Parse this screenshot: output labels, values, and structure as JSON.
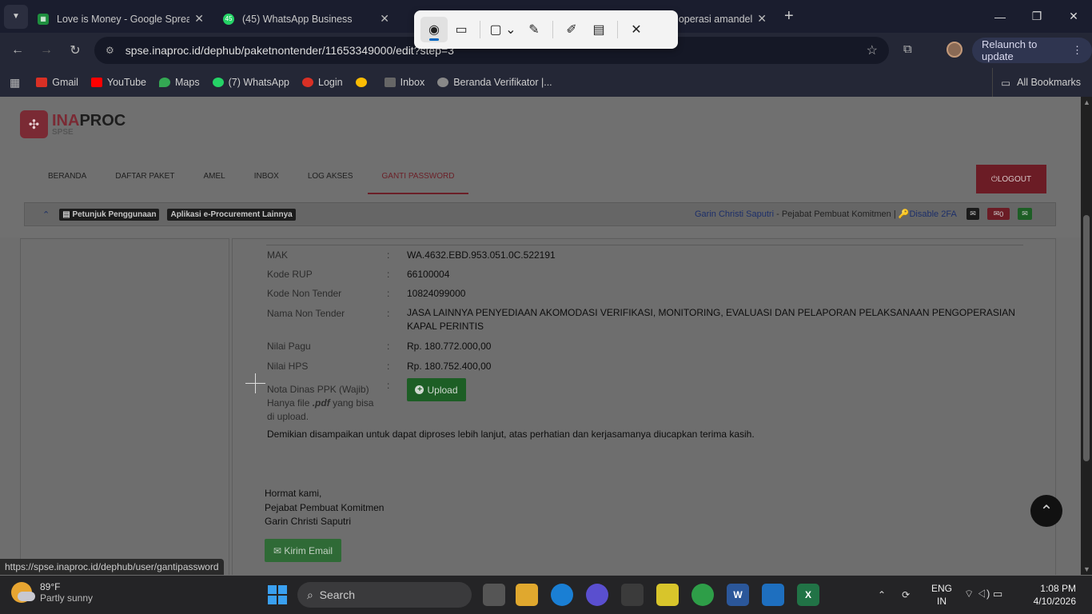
{
  "browser": {
    "tabs": [
      {
        "title": "Love is Money - Google Spread",
        "favicon_color": "#1e8e3e"
      },
      {
        "title": "(45) WhatsApp Business",
        "favicon_color": "#25d366",
        "badge": "45"
      },
      {
        "title": "",
        "favicon_color": "#888"
      },
      {
        "title": "a operasi amandel",
        "favicon_color": "#888"
      }
    ],
    "url": "spse.inaproc.id/dephub/paketnontender/11653349000/edit?step=3",
    "relaunch_label": "Relaunch to update",
    "bookmarks": [
      {
        "label": "Gmail",
        "color": "#d93025"
      },
      {
        "label": "YouTube",
        "color": "#ff0000"
      },
      {
        "label": "Maps",
        "color": "#34a853"
      },
      {
        "label": "(7) WhatsApp",
        "color": "#25d366"
      },
      {
        "label": "Login",
        "color": "#d93025"
      },
      {
        "label": "",
        "color": "#fbbc04"
      },
      {
        "label": "Inbox",
        "color": "#666"
      },
      {
        "label": "Beranda Verifikator |...",
        "color": "#888"
      }
    ],
    "all_bookmarks": "All Bookmarks"
  },
  "site": {
    "logo_main_a": "INA",
    "logo_main_b": "PROC",
    "logo_sub": "SPSE",
    "menu": [
      "BERANDA",
      "DAFTAR PAKET",
      "AMEL",
      "INBOX",
      "LOG AKSES",
      "GANTI PASSWORD"
    ],
    "logout": "LOGOUT",
    "guide_btn": "Petunjuk Penggunaan",
    "apps_btn": "Aplikasi e-Procurement Lainnya",
    "user_name": "Garin Christi Saputri",
    "user_role": "- Pejabat Pembuat Komitmen |",
    "disable_2fa": "Disable 2FA",
    "mail_count": "0"
  },
  "details": [
    {
      "label": "MAK",
      "value": "WA.4632.EBD.953.051.0C.522191"
    },
    {
      "label": "Kode RUP",
      "value": "66100004"
    },
    {
      "label": "Kode Non Tender",
      "value": "10824099000"
    },
    {
      "label": "Nama Non Tender",
      "value": "JASA LAINNYA PENYEDIAAN AKOMODASI VERIFIKASI, MONITORING, EVALUASI DAN PELAPORAN PELAKSANAAN PENGOPERASIAN KAPAL PERINTIS"
    },
    {
      "label": "Nilai Pagu",
      "value": "Rp. 180.772.000,00"
    },
    {
      "label": "Nilai HPS",
      "value": "Rp. 180.752.400,00"
    }
  ],
  "nota": {
    "label": "Nota Dinas PPK (Wajib)",
    "hint_a": "Hanya file",
    "hint_ext": ".pdf",
    "hint_b": "yang bisa di upload.",
    "upload_label": "Upload"
  },
  "closing_text": "Demikian disampaikan untuk dapat diproses lebih lanjut, atas perhatian dan kerjasamanya diucapkan terima kasih.",
  "signature": [
    "Hormat kami,",
    "Pejabat Pembuat Komitmen",
    "Garin Christi Saputri"
  ],
  "send_email_label": "Kirim Email",
  "status_url": "https://spse.inaproc.id/dephub/user/gantipassword",
  "taskbar": {
    "temp": "89°F",
    "weather": "Partly sunny",
    "search_placeholder": "Search",
    "lang1": "ENG",
    "lang2": "IN",
    "time": "1:08 PM",
    "date": "4/10/2026"
  }
}
